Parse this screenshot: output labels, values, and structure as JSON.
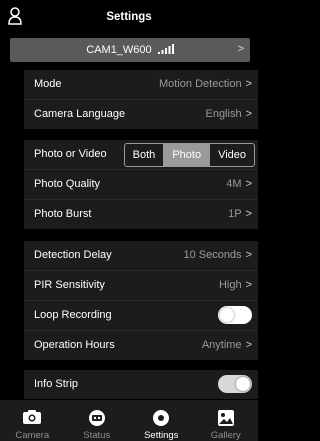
{
  "header": {
    "title": "Settings",
    "user_icon": "user-icon"
  },
  "device": {
    "name": "CAM1_W600",
    "chevron": ">",
    "signal_icon": "signal-bars-icon"
  },
  "section1": {
    "mode": {
      "label": "Mode",
      "value": "Motion Detection"
    },
    "language": {
      "label": "Camera Language",
      "value": "English"
    }
  },
  "section2": {
    "photo_video": {
      "label": "Photo or Video",
      "options": [
        "Both",
        "Photo",
        "Video"
      ],
      "selected": "Photo"
    },
    "photo_quality": {
      "label": "Photo Quality",
      "value": "4M"
    },
    "photo_burst": {
      "label": "Photo Burst",
      "value": "1P"
    }
  },
  "section3": {
    "detection_delay": {
      "label": "Detection Delay",
      "value": "10 Seconds"
    },
    "pir": {
      "label": "PIR Sensitivity",
      "value": "High"
    },
    "loop": {
      "label": "Loop Recording",
      "state": "off"
    },
    "hours": {
      "label": "Operation Hours",
      "value": "Anytime"
    }
  },
  "section4": {
    "info_strip": {
      "label": "Info Strip",
      "state": "on"
    }
  },
  "chevron": ">",
  "tabs": [
    {
      "label": "Camera",
      "icon": "camera-icon"
    },
    {
      "label": "Status",
      "icon": "status-icon"
    },
    {
      "label": "Settings",
      "icon": "settings-icon",
      "active": true
    },
    {
      "label": "Gallery",
      "icon": "gallery-icon"
    }
  ],
  "colors": {
    "background": "#000000",
    "section": "#1c1c1e",
    "device_bar": "#5a5a5a",
    "segment_active": "#9a9a9a"
  }
}
